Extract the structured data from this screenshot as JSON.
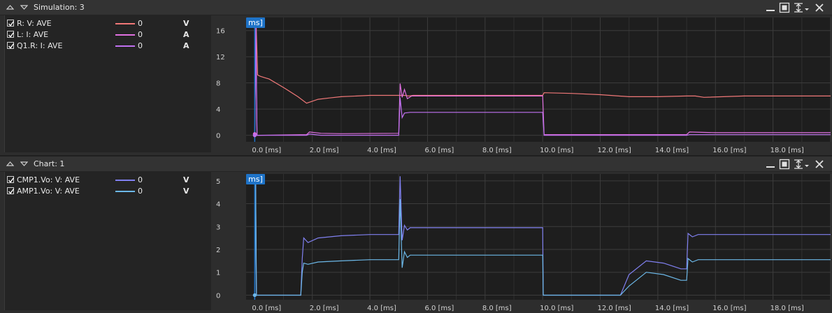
{
  "panels": [
    {
      "title": "Simulation: 3",
      "cursor_label": "ms]",
      "legend": [
        {
          "name": "R: V: AVE",
          "value": "0",
          "unit": "V",
          "color": "#f07878",
          "checked": true
        },
        {
          "name": "L: I: AVE",
          "value": "0",
          "unit": "A",
          "color": "#e070e0",
          "checked": true
        },
        {
          "name": "Q1.R: I: AVE",
          "value": "0",
          "unit": "A",
          "color": "#c070f0",
          "checked": true
        }
      ],
      "chart_data": {
        "type": "line",
        "xlabel": "",
        "ylabel": "",
        "xlim": [
          -0.3,
          20.0
        ],
        "ylim": [
          -1.0,
          18.0
        ],
        "x_ticks": [
          "0.0 [ms]",
          "2.0 [ms]",
          "4.0 [ms]",
          "6.0 [ms]",
          "8.0 [ms]",
          "10.0 [ms]",
          "12.0 [ms]",
          "14.0 [ms]",
          "16.0 [ms]",
          "18.0 [ms]"
        ],
        "x_tick_values": [
          0,
          2,
          4,
          6,
          8,
          10,
          12,
          14,
          16,
          18
        ],
        "y_ticks": [
          "0",
          "4",
          "8",
          "12",
          "16"
        ],
        "y_tick_values": [
          0,
          4,
          8,
          12,
          16
        ],
        "grid": true,
        "series": [
          {
            "color": "#f07878",
            "x": [
              0,
              0.05,
              0.1,
              0.2,
              0.5,
              1.0,
              1.5,
              1.8,
              2.2,
              2.6,
              3.0,
              4.0,
              5.0,
              5.2,
              5.35,
              5.5,
              10.0,
              10.05,
              11.0,
              12.0,
              13.0,
              14.0,
              15.0,
              15.3,
              15.6,
              17.0,
              20.0
            ],
            "y": [
              0,
              17.0,
              9.2,
              9.0,
              8.6,
              7.3,
              5.9,
              4.9,
              5.5,
              5.7,
              5.9,
              6.1,
              6.1,
              6.1,
              6.0,
              6.1,
              6.1,
              6.5,
              6.4,
              6.2,
              5.9,
              5.9,
              6.0,
              6.0,
              5.8,
              6.0,
              6.0
            ]
          },
          {
            "color": "#e070e0",
            "x": [
              0,
              0.04,
              0.08,
              0.15,
              1.8,
              1.9,
              2.3,
              3.0,
              5.0,
              5.05,
              5.12,
              5.2,
              5.3,
              5.45,
              10.0,
              10.05,
              15.0,
              15.1,
              16.0,
              20.0
            ],
            "y": [
              0.2,
              17.5,
              0,
              0,
              0.1,
              0.5,
              0.3,
              0.25,
              0.3,
              7.9,
              5.8,
              7.0,
              5.6,
              6.0,
              6.0,
              0.1,
              0.1,
              0.5,
              0.4,
              0.4
            ]
          },
          {
            "color": "#c070f0",
            "x": [
              0,
              0.04,
              0.08,
              0.15,
              1.8,
              1.9,
              2.3,
              3.0,
              5.0,
              5.05,
              5.12,
              5.2,
              5.4,
              10.0,
              10.05,
              15.0,
              15.1,
              16.0,
              20.0
            ],
            "y": [
              0.0,
              16.5,
              0,
              0,
              0,
              0.2,
              0.0,
              0.0,
              0,
              5.7,
              2.7,
              3.4,
              3.5,
              3.5,
              0.0,
              0.0,
              0.1,
              0.1,
              0.1
            ]
          }
        ]
      }
    },
    {
      "title": "Chart: 1",
      "cursor_label": "ms]",
      "legend": [
        {
          "name": "CMP1.Vo: V: AVE",
          "value": "0",
          "unit": "V",
          "color": "#8080f0",
          "checked": true
        },
        {
          "name": "AMP1.Vo: V: AVE",
          "value": "0",
          "unit": "V",
          "color": "#6cb8e8",
          "checked": true
        }
      ],
      "chart_data": {
        "type": "line",
        "xlabel": "",
        "ylabel": "",
        "xlim": [
          -0.3,
          20.0
        ],
        "ylim": [
          -0.2,
          5.3
        ],
        "x_ticks": [
          "0.0 [ms]",
          "2.0 [ms]",
          "4.0 [ms]",
          "6.0 [ms]",
          "8.0 [ms]",
          "10.0 [ms]",
          "12.0 [ms]",
          "14.0 [ms]",
          "16.0 [ms]",
          "18.0 [ms]"
        ],
        "x_tick_values": [
          0,
          2,
          4,
          6,
          8,
          10,
          12,
          14,
          16,
          18
        ],
        "y_ticks": [
          "0",
          "1",
          "2",
          "3",
          "4",
          "5"
        ],
        "y_tick_values": [
          0,
          1,
          2,
          3,
          4,
          5
        ],
        "grid": true,
        "series": [
          {
            "color": "#8080f0",
            "x": [
              0,
              0.03,
              0.06,
              0.1,
              1.6,
              1.65,
              1.7,
              1.85,
              2.2,
              3.0,
              4.0,
              5.0,
              5.05,
              5.12,
              5.2,
              5.3,
              5.4,
              10.0,
              10.02,
              12.7,
              13.0,
              13.6,
              14.2,
              14.8,
              15.0,
              15.05,
              15.2,
              15.4,
              16.0,
              20.0
            ],
            "y": [
              0,
              5.3,
              0,
              0,
              0,
              1.6,
              2.5,
              2.3,
              2.5,
              2.6,
              2.65,
              2.65,
              5.2,
              2.4,
              3.05,
              2.85,
              2.95,
              2.95,
              0,
              0,
              0.9,
              1.5,
              1.4,
              1.15,
              1.15,
              2.7,
              2.55,
              2.65,
              2.65,
              2.65
            ]
          },
          {
            "color": "#6cb8e8",
            "x": [
              0,
              0.03,
              0.06,
              0.1,
              1.6,
              1.65,
              1.7,
              1.85,
              2.2,
              3.0,
              4.0,
              5.0,
              5.05,
              5.12,
              5.2,
              5.3,
              5.4,
              10.0,
              10.02,
              12.7,
              13.0,
              13.6,
              14.2,
              14.8,
              15.0,
              15.05,
              15.2,
              15.4,
              16.0,
              20.0
            ],
            "y": [
              0,
              4.9,
              0,
              0,
              0,
              1.0,
              1.4,
              1.35,
              1.45,
              1.5,
              1.55,
              1.55,
              4.2,
              1.2,
              1.9,
              1.65,
              1.75,
              1.75,
              0,
              0,
              0.4,
              1.0,
              0.9,
              0.65,
              0.65,
              1.6,
              1.45,
              1.55,
              1.55,
              1.55
            ]
          }
        ]
      }
    }
  ]
}
